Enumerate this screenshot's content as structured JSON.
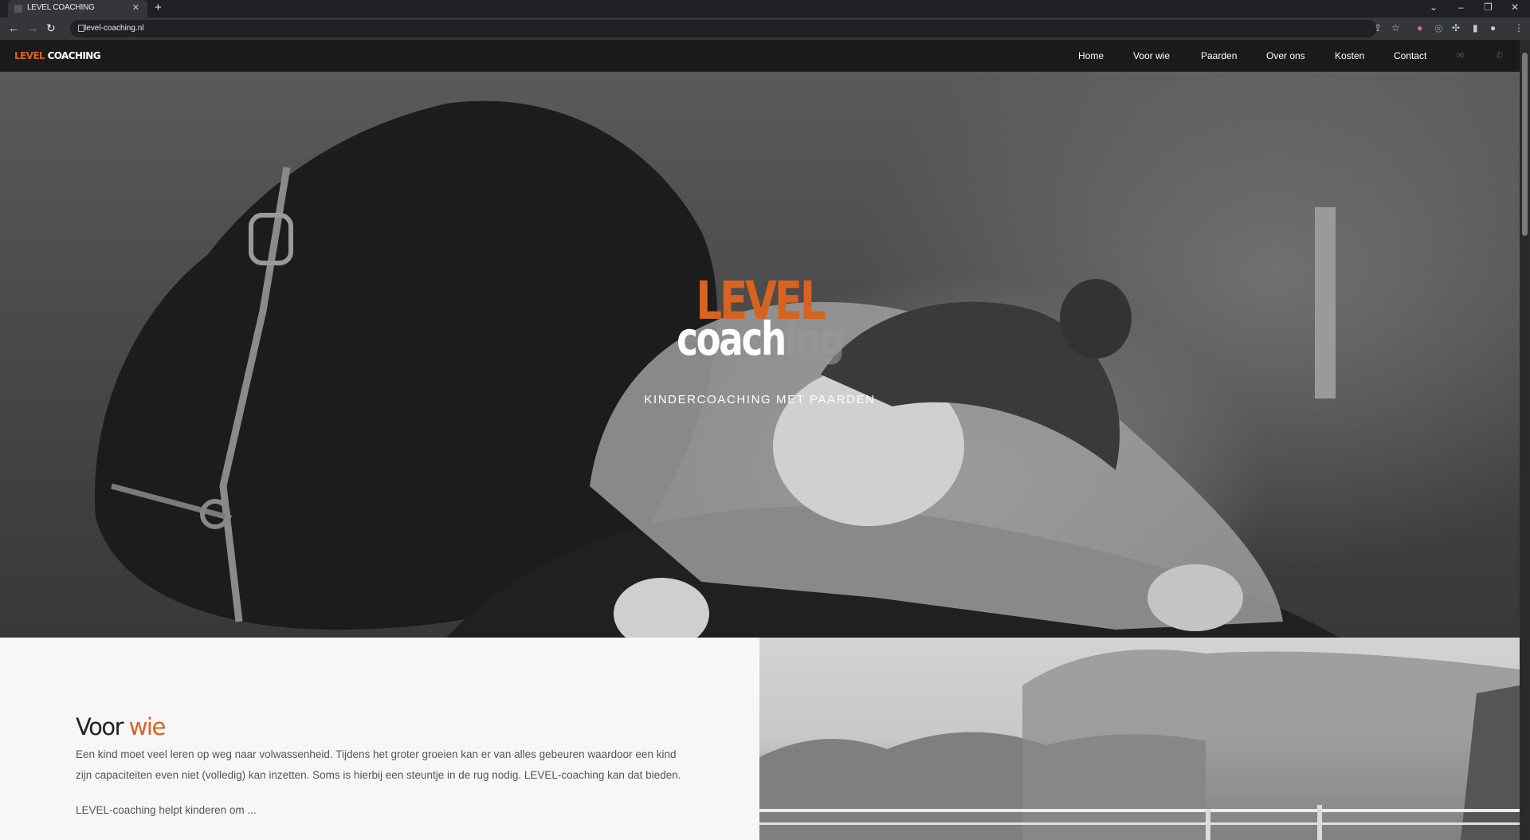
{
  "browser": {
    "tab_title": "LEVEL COACHING",
    "url": "level-coaching.nl"
  },
  "site": {
    "logo": {
      "level": "LEVEL",
      "coaching": "COACHING",
      "color": "#d7631f"
    },
    "nav": [
      {
        "label": "Home"
      },
      {
        "label": "Voor wie"
      },
      {
        "label": "Paarden"
      },
      {
        "label": "Over ons"
      },
      {
        "label": "Kosten"
      },
      {
        "label": "Contact"
      }
    ],
    "nav_icons": [
      "mail-icon",
      "phone-icon"
    ],
    "hero": {
      "title_level": "LEVEL",
      "title_coach": "coach",
      "title_ing": "ing",
      "subtitle": "KINDERCOACHING MET PAARDEN"
    },
    "voor_wie": {
      "title_main": "Voor",
      "title_accent": "wie",
      "paragraph": "Een kind moet veel leren op weg naar volwassenheid. Tijdens het groter groeien kan er van alles gebeuren waardoor een kind zijn capaciteiten even niet (volledig) kan inzetten. Soms is hierbij een steuntje in de rug nodig. LEVEL-coaching kan dat bieden.",
      "more": "LEVEL-coaching helpt kinderen om ..."
    }
  }
}
